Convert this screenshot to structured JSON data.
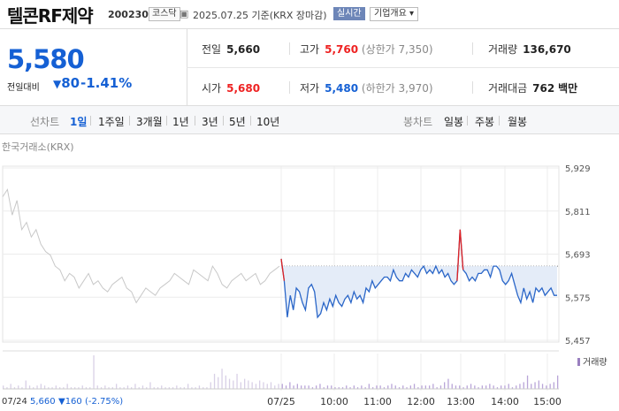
{
  "header": {
    "name": "텔콘RF제약",
    "code": "200230",
    "market": "코스닥",
    "date": "2025.07.25",
    "basis": "기준(KRX 장마감)",
    "realtime": "실시간",
    "company_info": "기업개요 ▾"
  },
  "quote": {
    "price": "5,580",
    "change_label": "전일대비",
    "change_amount": "80",
    "change_rate": "-1.41%",
    "prev": {
      "label": "전일",
      "value": "5,660"
    },
    "high": {
      "label": "고가",
      "value": "5,760",
      "sub": "(상한가 7,350)"
    },
    "volume": {
      "label": "거래량",
      "value": "136,670"
    },
    "open": {
      "label": "시가",
      "value": "5,680"
    },
    "low": {
      "label": "저가",
      "value": "5,480",
      "sub": "(하한가 3,970)"
    },
    "amount": {
      "label": "거래대금",
      "value": "762",
      "unit": "백만"
    }
  },
  "line_chart_bar": {
    "label": "선차트",
    "periods": [
      "1일",
      "1주일",
      "3개월",
      "1년",
      "3년",
      "5년",
      "10년"
    ],
    "selected": "1일"
  },
  "candle_bar": {
    "label": "봉차트",
    "periods": [
      "일봉",
      "주봉",
      "월봉"
    ]
  },
  "chart": {
    "source": "한국거래소(KRX)",
    "volume_label": "거래량",
    "bottom_left": "07/24",
    "bottom_prev_price": "5,660",
    "bottom_change": "▼160 (-2.75%)"
  },
  "colors": {
    "up": "#e22222",
    "down": "#1560d4",
    "line": "#2a66c8",
    "fill": "#e4ecf8",
    "prev": "#c8c8c8"
  },
  "chart_data": {
    "type": "line",
    "title": "",
    "y_ticks": [
      5929,
      5811,
      5693,
      5575,
      5457
    ],
    "ylim": [
      5457,
      5929
    ],
    "x_ticks": [
      "07/25",
      "10:00",
      "11:00",
      "12:00",
      "13:00",
      "14:00",
      "15:00"
    ],
    "reference": 5660,
    "series": [
      {
        "session": "07/24",
        "values": [
          5850,
          5870,
          5800,
          5840,
          5760,
          5780,
          5740,
          5760,
          5720,
          5700,
          5690,
          5660,
          5650,
          5620,
          5640,
          5630,
          5600,
          5620,
          5640,
          5610,
          5620,
          5600,
          5590,
          5610,
          5620,
          5630,
          5600,
          5590,
          5560,
          5580,
          5600,
          5590,
          5580,
          5600,
          5610,
          5620,
          5640,
          5630,
          5620,
          5610,
          5650,
          5640,
          5630,
          5620,
          5660,
          5640,
          5610,
          5600,
          5620,
          5630,
          5640,
          5620,
          5630,
          5640,
          5610,
          5620,
          5640,
          5650,
          5660
        ]
      },
      {
        "session": "07/25",
        "values": [
          5680,
          5620,
          5520,
          5580,
          5540,
          5600,
          5590,
          5560,
          5540,
          5600,
          5610,
          5590,
          5520,
          5530,
          5560,
          5540,
          5570,
          5550,
          5580,
          5560,
          5550,
          5570,
          5580,
          5560,
          5590,
          5570,
          5580,
          5560,
          5600,
          5590,
          5620,
          5600,
          5610,
          5620,
          5630,
          5630,
          5620,
          5650,
          5630,
          5620,
          5620,
          5640,
          5630,
          5650,
          5640,
          5630,
          5650,
          5660,
          5640,
          5650,
          5640,
          5660,
          5640,
          5650,
          5630,
          5640,
          5620,
          5610,
          5620,
          5760,
          5650,
          5640,
          5620,
          5630,
          5620,
          5640,
          5640,
          5650,
          5650,
          5630,
          5660,
          5660,
          5650,
          5620,
          5610,
          5620,
          5640,
          5610,
          5580,
          5560,
          5600,
          5570,
          5590,
          5560,
          5600,
          5590,
          5600,
          5580,
          5590,
          5600,
          5580,
          5580
        ]
      }
    ],
    "volume": [
      2,
      1,
      3,
      1,
      2,
      1,
      5,
      2,
      1,
      2,
      3,
      2,
      1,
      1,
      2,
      1,
      1,
      3,
      1,
      1,
      1,
      2,
      1,
      1,
      20,
      2,
      1,
      2,
      1,
      1,
      3,
      1,
      1,
      2,
      1,
      3,
      1,
      2,
      1,
      4,
      1,
      1,
      2,
      1,
      1,
      1,
      2,
      1,
      1,
      3,
      1,
      1,
      2,
      1,
      1,
      4,
      9,
      7,
      12,
      8,
      6,
      5,
      9,
      4,
      6,
      5,
      4,
      3,
      5,
      4,
      3,
      4,
      2,
      3,
      3,
      2,
      4,
      2,
      3,
      2,
      2,
      2,
      1,
      2,
      3,
      1,
      2,
      2,
      1,
      1,
      1,
      2,
      1,
      2,
      1,
      2,
      1,
      3,
      1,
      2,
      2,
      1,
      2,
      3,
      2,
      1,
      2,
      1,
      2,
      3,
      1,
      2,
      2,
      2,
      3,
      1,
      2,
      4,
      6,
      3,
      2,
      2,
      1,
      2,
      3,
      2,
      1,
      2,
      2,
      3,
      2,
      1,
      2,
      2,
      3,
      1,
      2,
      3,
      4,
      8,
      3,
      4,
      5,
      3,
      2,
      3,
      4,
      8
    ]
  }
}
